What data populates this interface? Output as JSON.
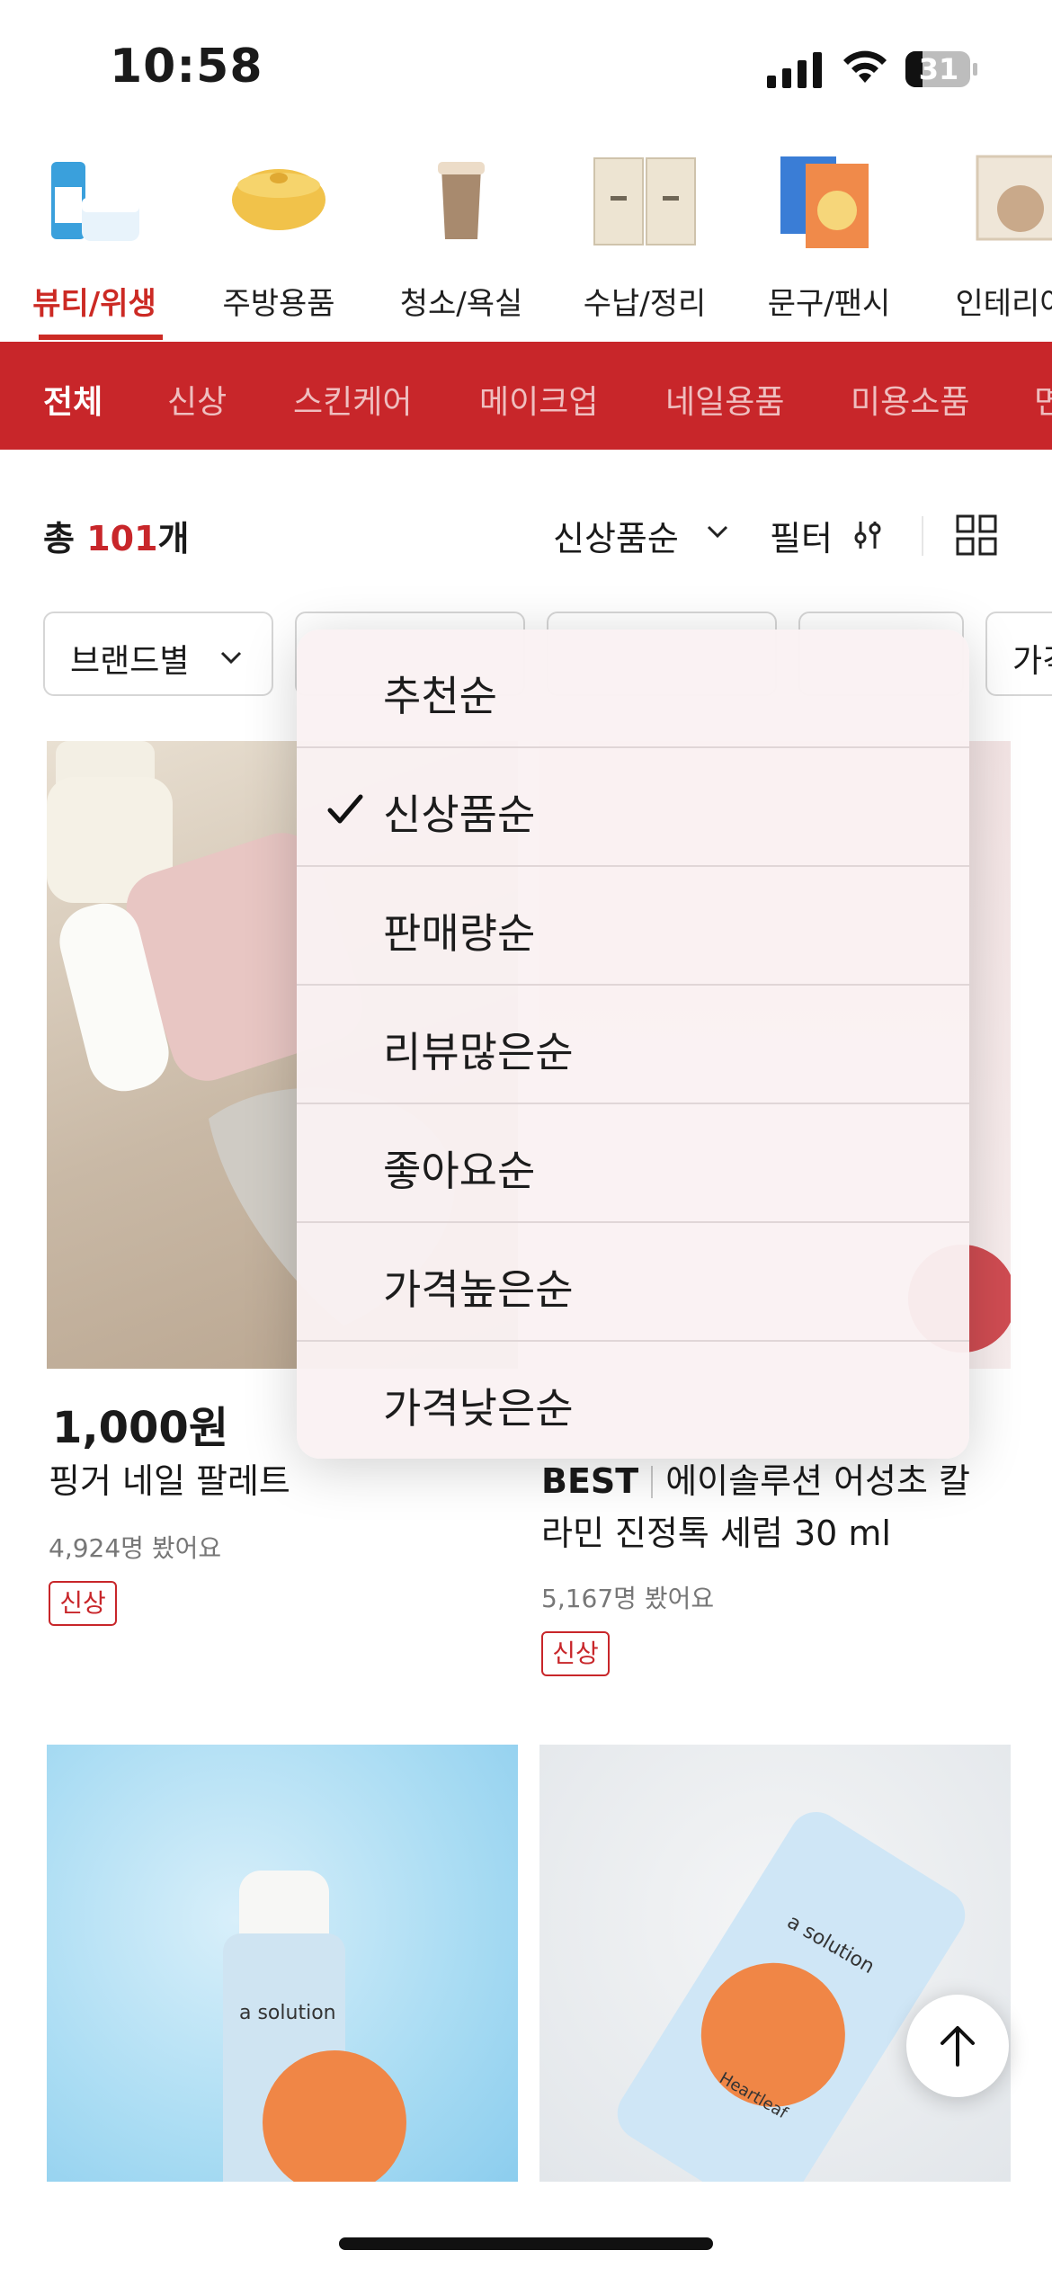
{
  "status_bar": {
    "time": "10:58",
    "battery": "31"
  },
  "categories": [
    {
      "label": "뷰티/위생",
      "icon": "beauty-product-thumbnail",
      "active": true
    },
    {
      "label": "주방용품",
      "icon": "kitchen-pot-thumbnail"
    },
    {
      "label": "청소/욕실",
      "icon": "trash-bin-thumbnail"
    },
    {
      "label": "수납/정리",
      "icon": "storage-box-thumbnail"
    },
    {
      "label": "문구/팬시",
      "icon": "notebook-thumbnail"
    },
    {
      "label": "인테리어",
      "icon": "frame-thumbnail"
    }
  ],
  "subcategories": [
    "전체",
    "신상",
    "스킨케어",
    "메이크업",
    "네일용품",
    "미용소품",
    "면"
  ],
  "toolbar": {
    "total_prefix": "총 ",
    "total_count": "101",
    "total_suffix": "개",
    "sort_label": "신상품순",
    "filter_label": "필터"
  },
  "chips": [
    "브랜드별",
    "",
    "",
    "",
    "가격"
  ],
  "products": [
    {
      "price": "1,000원",
      "name": "핑거 네일 팔레트",
      "views": "4,924명 봤어요",
      "tag": "신상"
    },
    {
      "best": "BEST",
      "name_line1": "에이솔루션 어성초 칼",
      "name_line2": "라민 진정톡 세럼 30 ml",
      "views": "5,167명 봤어요",
      "tag": "신상"
    }
  ],
  "product_art_text": {
    "brand_a": "a solution",
    "brand_b": "a solution",
    "product_b": "Heartleaf"
  },
  "sort_dropdown": {
    "selected": "신상품순",
    "options": [
      "추천순",
      "신상품순",
      "판매량순",
      "리뷰많은순",
      "좋아요순",
      "가격높은순",
      "가격낮은순"
    ]
  },
  "colors": {
    "accent": "#c8262a",
    "menu_bg": "#faf1f2"
  }
}
